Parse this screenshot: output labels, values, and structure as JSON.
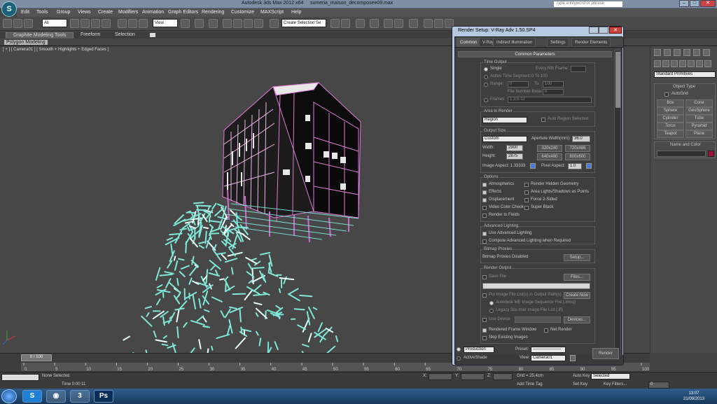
{
  "titlebar": {
    "app_title": "Autodesk 3ds Max 2012 x64",
    "file_name": "sumeria_maison_decomposee09.max",
    "search_placeholder": "Type a keyword or phrase"
  },
  "menu": [
    "Edit",
    "Tools",
    "Group",
    "Views",
    "Create",
    "Modifiers",
    "Animation",
    "Graph Editors",
    "Rendering",
    "Customize",
    "MAXScript",
    "Help"
  ],
  "toolbar": {
    "selection_filter": "All",
    "ref_coord": "View",
    "named_selection": "Create Selection Se"
  },
  "ribbon": {
    "tabs": [
      "Graphite Modeling Tools",
      "Freeform",
      "Selection"
    ],
    "panel": "Polygon Modeling"
  },
  "viewport": {
    "label": "[ + ] [ Camera01 ] [ Smooth + Highlights + Edged Faces ]"
  },
  "command_panel": {
    "dropdown": "Standard Primitives",
    "object_type_title": "Object Type",
    "autogrid": "AutoGrid",
    "buttons": [
      "Box",
      "Cone",
      "Sphere",
      "GeoSphere",
      "Cylinder",
      "Tube",
      "Torus",
      "Pyramid",
      "Teapot",
      "Plane"
    ],
    "name_color_title": "Name and Color"
  },
  "dialog": {
    "title": "Render Setup: V-Ray Adv 1.50.SP4",
    "tabs": [
      "Common",
      "V-Ray",
      "Indirect illumination",
      "Settings",
      "Render Elements"
    ],
    "rollout": "Common Parameters",
    "time_output": {
      "title": "Time Output",
      "single": "Single",
      "every_nth": "Every Nth Frame:",
      "active_segment": "Active Time Segment:",
      "active_range": "0 To 100",
      "range": "Range:",
      "range_from": "0",
      "range_to_label": "To",
      "range_to": "100",
      "file_number_base": "File Number Base:",
      "file_number_value": "0",
      "frames": "Frames",
      "frames_value": "1,3,5-12"
    },
    "area_to_render": {
      "title": "Area to Render",
      "value": "Region",
      "auto_region": "Auto Region Selected"
    },
    "output_size": {
      "title": "Output Size",
      "preset": "Custom",
      "aperture_label": "Aperture Width(mm):",
      "aperture_value": "36.0",
      "width_label": "Width:",
      "width_value": "2900",
      "height_label": "Height:",
      "height_value": "2875",
      "presets": [
        "320x240",
        "720x486",
        "640x480",
        "800x600"
      ],
      "aspect_label": "Image Aspect: 1.33333",
      "pixel_aspect_label": "Pixel Aspect:",
      "pixel_aspect_value": "1.0"
    },
    "options": {
      "title": "Options",
      "left": [
        "Atmospherics",
        "Effects",
        "Displacement",
        "Video Color Check",
        "Render to Fields"
      ],
      "left_checked": [
        true,
        true,
        true,
        false,
        false
      ],
      "right": [
        "Render Hidden Geometry",
        "Area Lights/Shadows as Points",
        "Force 2-Sided",
        "Super Black"
      ]
    },
    "advanced_lighting": {
      "title": "Advanced Lighting",
      "use": "Use Advanced Lighting",
      "compute": "Compute Advanced Lighting when Required"
    },
    "bitmap_proxies": {
      "title": "Bitmap Proxies",
      "status": "Bitmap Proxies Disabled",
      "setup": "Setup..."
    },
    "render_output": {
      "title": "Render Output",
      "save_file": "Save File",
      "files": "Files...",
      "put_image": "Put Image File List(s) in Output Path(s)",
      "create_now": "Create Now",
      "autodesk_ifl": "Autodesk ME Image Sequence File (.imsq)",
      "legacy_ifl": "Legacy 3ds max Image File List (.ifl)",
      "use_device": "Use Device",
      "devices": "Devices...",
      "rendered_frame_window": "Rendered Frame Window",
      "net_render": "Net Render",
      "skip_existing": "Skip Existing Images"
    },
    "bottom": {
      "production": "Production",
      "activeshade": "ActiveShade",
      "preset_label": "Preset:",
      "preset_value": "--------------------",
      "view_label": "View:",
      "view_value": "Camera01",
      "render": "Render"
    }
  },
  "timeline": {
    "slider": "0 / 100",
    "ticks": [
      "0",
      "5",
      "10",
      "15",
      "20",
      "25",
      "30",
      "35",
      "40",
      "45",
      "50",
      "55",
      "60",
      "65",
      "70",
      "75",
      "80",
      "85",
      "90",
      "95",
      "100"
    ]
  },
  "status": {
    "selection": "None Selected",
    "time": "Time 0:00:11",
    "x_label": "X:",
    "y_label": "Y:",
    "z_label": "Z:",
    "grid": "Grid = 25,4cm",
    "add_time_tag": "Add Time Tag",
    "auto_key": "Auto Key",
    "selected": "Selected",
    "set_key": "Set Key",
    "key_filters": "Key Filters...",
    "frame": "0"
  },
  "taskbar": {
    "clock_time": "13:07",
    "clock_date": "21/09/2013"
  },
  "colors": {
    "building_edges": "#e07ad8",
    "debris": "#7fe8d8",
    "dialog_frame": "#b5c9e3",
    "swatch": "#a0103a"
  }
}
